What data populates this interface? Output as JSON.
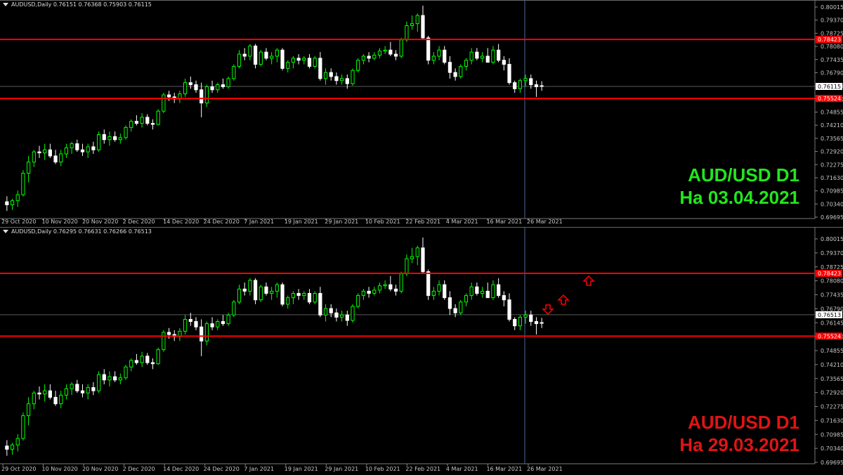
{
  "colors": {
    "bull": "#00ff00",
    "bear": "#ffffff",
    "hline": "#ff0000",
    "grid": "#5a5a5a",
    "axis": "#c8c8c8",
    "vline": "#4a6a9a",
    "arrow": "#ff0000"
  },
  "panels": [
    {
      "header": "AUDUSD,Daily  0.76151 0.76368 0.75903 0.76115",
      "price_labels": [
        "0.80015",
        "0.79370",
        "0.78725",
        "0.78080",
        "0.77435",
        "0.76790",
        "0.76145",
        "0.75500",
        "0.74855",
        "0.74210",
        "0.73565",
        "0.72920",
        "0.72275",
        "0.71630",
        "0.70985",
        "0.70340",
        "0.69695"
      ],
      "current_price": "0.76115",
      "level_upper": "0.78423",
      "level_lower": "0.75524",
      "date_labels": [
        "29 Oct 2020",
        "10 Nov 2020",
        "20 Nov 2020",
        "2 Dec 2020",
        "14 Dec 2020",
        "24 Dec 2020",
        "7 Jan 2021",
        "19 Jan 2021",
        "29 Jan 2021",
        "10 Feb 2021",
        "22 Feb 2021",
        "4 Mar 2021",
        "16 Mar 2021",
        "26 Mar 2021"
      ],
      "title_line1": "AUD/USD D1",
      "title_line2": "Ha 03.04.2021"
    },
    {
      "header": "AUDUSD,Daily  0.76295 0.76631 0.76266 0.76513",
      "price_labels": [
        "0.80015",
        "0.79370",
        "0.78725",
        "0.78080",
        "0.77435",
        "0.76790",
        "0.76145",
        "0.75500",
        "0.74855",
        "0.74210",
        "0.73565",
        "0.72920",
        "0.72275",
        "0.71630",
        "0.70985",
        "0.70340",
        "0.69695"
      ],
      "current_price": "0.76513",
      "level_upper": "0.78423",
      "level_lower": "0.75524",
      "date_labels": [
        "29 Oct 2020",
        "10 Nov 2020",
        "20 Nov 2020",
        "2 Dec 2020",
        "14 Dec 2020",
        "24 Dec 2020",
        "7 Jan 2021",
        "19 Jan 2021",
        "29 Jan 2021",
        "10 Feb 2021",
        "22 Feb 2021",
        "4 Mar 2021",
        "16 Mar 2021",
        "26 Mar 2021"
      ],
      "title_line1": "AUD/USD D1",
      "title_line2": "Ha 29.03.2021"
    }
  ],
  "chart_data": {
    "type": "candlestick",
    "symbol": "AUDUSD",
    "timeframe": "Daily",
    "ylim": [
      0.69695,
      0.80015
    ],
    "ohlc": [
      [
        0.7045,
        0.7072,
        0.7,
        0.703
      ],
      [
        0.703,
        0.706,
        0.7005,
        0.705
      ],
      [
        0.705,
        0.71,
        0.702,
        0.708
      ],
      [
        0.708,
        0.72,
        0.707,
        0.7185
      ],
      [
        0.7185,
        0.727,
        0.714,
        0.724
      ],
      [
        0.724,
        0.73,
        0.7215,
        0.729
      ],
      [
        0.729,
        0.732,
        0.726,
        0.7285
      ],
      [
        0.7285,
        0.733,
        0.725,
        0.73
      ],
      [
        0.73,
        0.733,
        0.726,
        0.727
      ],
      [
        0.727,
        0.73,
        0.723,
        0.724
      ],
      [
        0.724,
        0.73,
        0.722,
        0.728
      ],
      [
        0.728,
        0.733,
        0.726,
        0.731
      ],
      [
        0.731,
        0.734,
        0.728,
        0.733
      ],
      [
        0.733,
        0.735,
        0.729,
        0.73
      ],
      [
        0.73,
        0.733,
        0.727,
        0.729
      ],
      [
        0.729,
        0.733,
        0.726,
        0.7315
      ],
      [
        0.7315,
        0.734,
        0.728,
        0.73
      ],
      [
        0.73,
        0.739,
        0.729,
        0.7375
      ],
      [
        0.7375,
        0.74,
        0.733,
        0.735
      ],
      [
        0.735,
        0.739,
        0.732,
        0.7365
      ],
      [
        0.7365,
        0.739,
        0.734,
        0.735
      ],
      [
        0.735,
        0.738,
        0.733,
        0.736
      ],
      [
        0.736,
        0.742,
        0.735,
        0.741
      ],
      [
        0.741,
        0.745,
        0.739,
        0.744
      ],
      [
        0.744,
        0.747,
        0.742,
        0.743
      ],
      [
        0.743,
        0.748,
        0.741,
        0.746
      ],
      [
        0.746,
        0.7475,
        0.742,
        0.743
      ],
      [
        0.743,
        0.745,
        0.74,
        0.7425
      ],
      [
        0.7425,
        0.75,
        0.742,
        0.749
      ],
      [
        0.749,
        0.758,
        0.748,
        0.757
      ],
      [
        0.757,
        0.759,
        0.754,
        0.756
      ],
      [
        0.756,
        0.758,
        0.753,
        0.755
      ],
      [
        0.755,
        0.759,
        0.753,
        0.7575
      ],
      [
        0.7575,
        0.765,
        0.756,
        0.763
      ],
      [
        0.763,
        0.766,
        0.76,
        0.762
      ],
      [
        0.762,
        0.764,
        0.758,
        0.7595
      ],
      [
        0.7595,
        0.763,
        0.746,
        0.753
      ],
      [
        0.753,
        0.762,
        0.751,
        0.761
      ],
      [
        0.761,
        0.764,
        0.758,
        0.7595
      ],
      [
        0.7595,
        0.763,
        0.758,
        0.762
      ],
      [
        0.762,
        0.765,
        0.76,
        0.761
      ],
      [
        0.761,
        0.766,
        0.76,
        0.765
      ],
      [
        0.765,
        0.772,
        0.764,
        0.771
      ],
      [
        0.771,
        0.779,
        0.77,
        0.777
      ],
      [
        0.777,
        0.78,
        0.774,
        0.776
      ],
      [
        0.776,
        0.782,
        0.774,
        0.781
      ],
      [
        0.781,
        0.782,
        0.77,
        0.772
      ],
      [
        0.772,
        0.779,
        0.771,
        0.778
      ],
      [
        0.778,
        0.78,
        0.774,
        0.775
      ],
      [
        0.775,
        0.778,
        0.772,
        0.776
      ],
      [
        0.776,
        0.78,
        0.773,
        0.779
      ],
      [
        0.779,
        0.78,
        0.769,
        0.77
      ],
      [
        0.77,
        0.774,
        0.768,
        0.773
      ],
      [
        0.773,
        0.776,
        0.77,
        0.775
      ],
      [
        0.775,
        0.777,
        0.772,
        0.774
      ],
      [
        0.774,
        0.776,
        0.772,
        0.775
      ],
      [
        0.775,
        0.777,
        0.77,
        0.771
      ],
      [
        0.771,
        0.776,
        0.77,
        0.775
      ],
      [
        0.775,
        0.778,
        0.764,
        0.765
      ],
      [
        0.765,
        0.77,
        0.762,
        0.768
      ],
      [
        0.768,
        0.77,
        0.764,
        0.766
      ],
      [
        0.766,
        0.768,
        0.762,
        0.764
      ],
      [
        0.764,
        0.767,
        0.762,
        0.765
      ],
      [
        0.765,
        0.767,
        0.76,
        0.7625
      ],
      [
        0.7625,
        0.77,
        0.7615,
        0.769
      ],
      [
        0.769,
        0.775,
        0.768,
        0.774
      ],
      [
        0.774,
        0.777,
        0.772,
        0.776
      ],
      [
        0.776,
        0.778,
        0.773,
        0.775
      ],
      [
        0.775,
        0.778,
        0.774,
        0.7765
      ],
      [
        0.7765,
        0.78,
        0.775,
        0.7785
      ],
      [
        0.7785,
        0.781,
        0.777,
        0.779
      ],
      [
        0.779,
        0.783,
        0.776,
        0.777
      ],
      [
        0.777,
        0.779,
        0.774,
        0.776
      ],
      [
        0.776,
        0.785,
        0.775,
        0.784
      ],
      [
        0.784,
        0.793,
        0.783,
        0.791
      ],
      [
        0.791,
        0.796,
        0.789,
        0.792
      ],
      [
        0.792,
        0.797,
        0.788,
        0.796
      ],
      [
        0.796,
        0.8008,
        0.784,
        0.785
      ],
      [
        0.785,
        0.786,
        0.772,
        0.774
      ],
      [
        0.774,
        0.778,
        0.772,
        0.776
      ],
      [
        0.776,
        0.781,
        0.774,
        0.779
      ],
      [
        0.779,
        0.781,
        0.772,
        0.773
      ],
      [
        0.773,
        0.776,
        0.765,
        0.768
      ],
      [
        0.768,
        0.77,
        0.764,
        0.766
      ],
      [
        0.766,
        0.772,
        0.765,
        0.771
      ],
      [
        0.771,
        0.775,
        0.769,
        0.774
      ],
      [
        0.774,
        0.78,
        0.772,
        0.778
      ],
      [
        0.778,
        0.78,
        0.774,
        0.775
      ],
      [
        0.775,
        0.778,
        0.773,
        0.776
      ],
      [
        0.776,
        0.78,
        0.774,
        0.773
      ],
      [
        0.773,
        0.781,
        0.772,
        0.779
      ],
      [
        0.779,
        0.782,
        0.773,
        0.774
      ],
      [
        0.774,
        0.776,
        0.769,
        0.772
      ],
      [
        0.772,
        0.775,
        0.762,
        0.763
      ],
      [
        0.763,
        0.764,
        0.758,
        0.76
      ],
      [
        0.76,
        0.765,
        0.758,
        0.764
      ],
      [
        0.764,
        0.767,
        0.761,
        0.765
      ],
      [
        0.765,
        0.767,
        0.76,
        0.762
      ],
      [
        0.762,
        0.764,
        0.756,
        0.761
      ],
      [
        0.7615,
        0.7637,
        0.759,
        0.7612
      ]
    ],
    "horizontal_levels": [
      0.78423,
      0.75524
    ]
  }
}
